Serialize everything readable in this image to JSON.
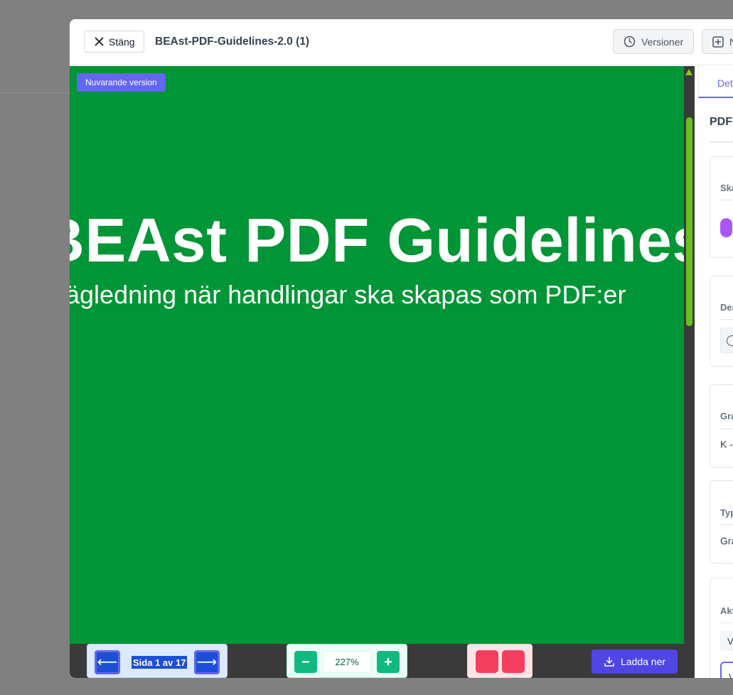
{
  "header": {
    "close_label": "Stäng",
    "document_title": "BEAst-PDF-Guidelines-2.0 (1)",
    "versions_label": "Versioner",
    "new_label": "N"
  },
  "viewer": {
    "version_badge": "Nuvarande version",
    "page_title": "BEAst PDF Guidelines",
    "page_subtitle": "Vägledning när handlingar ska skapas som PDF:er",
    "page_color": "#009536"
  },
  "toolbar": {
    "prev_symbol": "⟵",
    "next_symbol": "⟶",
    "page_indicator": "Sida 1 av 17",
    "zoom_out_symbol": "−",
    "zoom_in_symbol": "+",
    "zoom_level": "227%",
    "download_label": "Ladda ner"
  },
  "sidebar": {
    "tab_label": "Detaljer",
    "heading": "PDF",
    "cards": [
      {
        "label": "Skapad av"
      },
      {
        "label": "Deadline"
      },
      {
        "label": "Granskare",
        "value": "K - "
      },
      {
        "label": "Typ",
        "value": "Gra"
      },
      {
        "label": "Aktiviteter",
        "chip": "V",
        "item": "V"
      }
    ]
  },
  "colors": {
    "accent": "#6366f1",
    "scroll_thumb": "#65c31c",
    "zoom_accent": "#10b981",
    "action_accent": "#f43f5e",
    "download": "#4f46e5"
  }
}
